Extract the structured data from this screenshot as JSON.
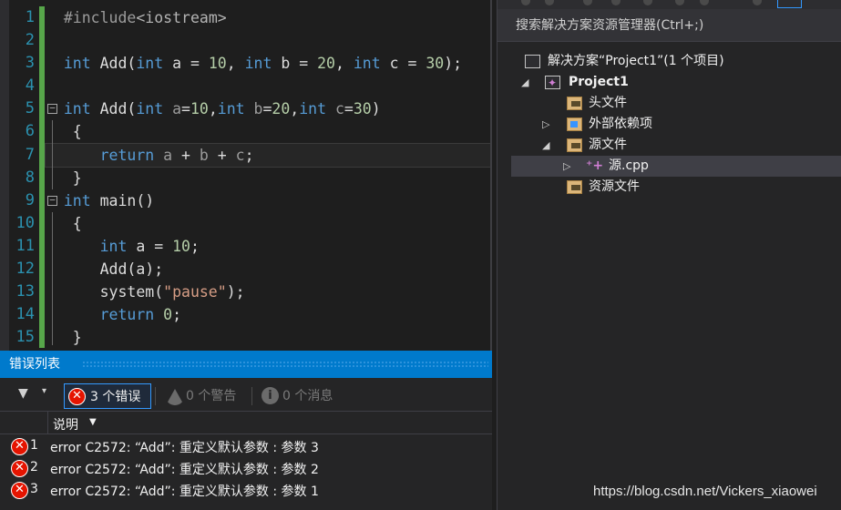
{
  "editor": {
    "line_numbers": [
      "1",
      "2",
      "3",
      "4",
      "5",
      "6",
      "7",
      "8",
      "9",
      "10",
      "11",
      "12",
      "13",
      "14",
      "15"
    ]
  },
  "error_list": {
    "title": "错误列表",
    "errors_chip": "3 个错误",
    "warnings_chip": "0 个警告",
    "messages_chip": "0 个消息",
    "column_description": "说明",
    "rows": [
      {
        "no": "1",
        "message": "error C2572: “Add”: 重定义默认参数 : 参数 3"
      },
      {
        "no": "2",
        "message": "error C2572: “Add”: 重定义默认参数 : 参数 2"
      },
      {
        "no": "3",
        "message": "error C2572: “Add”: 重定义默认参数 : 参数 1"
      }
    ]
  },
  "solution_explorer": {
    "search_placeholder": "搜索解决方案资源管理器(Ctrl+;)",
    "solution_label": "解决方案“Project1”(1 个项目)",
    "project_label": "Project1",
    "headers_label": "头文件",
    "external_deps_label": "外部依赖项",
    "source_files_label": "源文件",
    "source_file_cpp": "源.cpp",
    "resource_files_label": "资源文件"
  },
  "watermark": "https://blog.csdn.net/Vickers_xiaowei",
  "colors": {
    "accent": "#007acc",
    "error": "#e51400",
    "change_bar": "#57a64a",
    "keyword": "#569cd6",
    "number": "#b5cea8",
    "string": "#d69d85",
    "line_number": "#2b91af"
  }
}
